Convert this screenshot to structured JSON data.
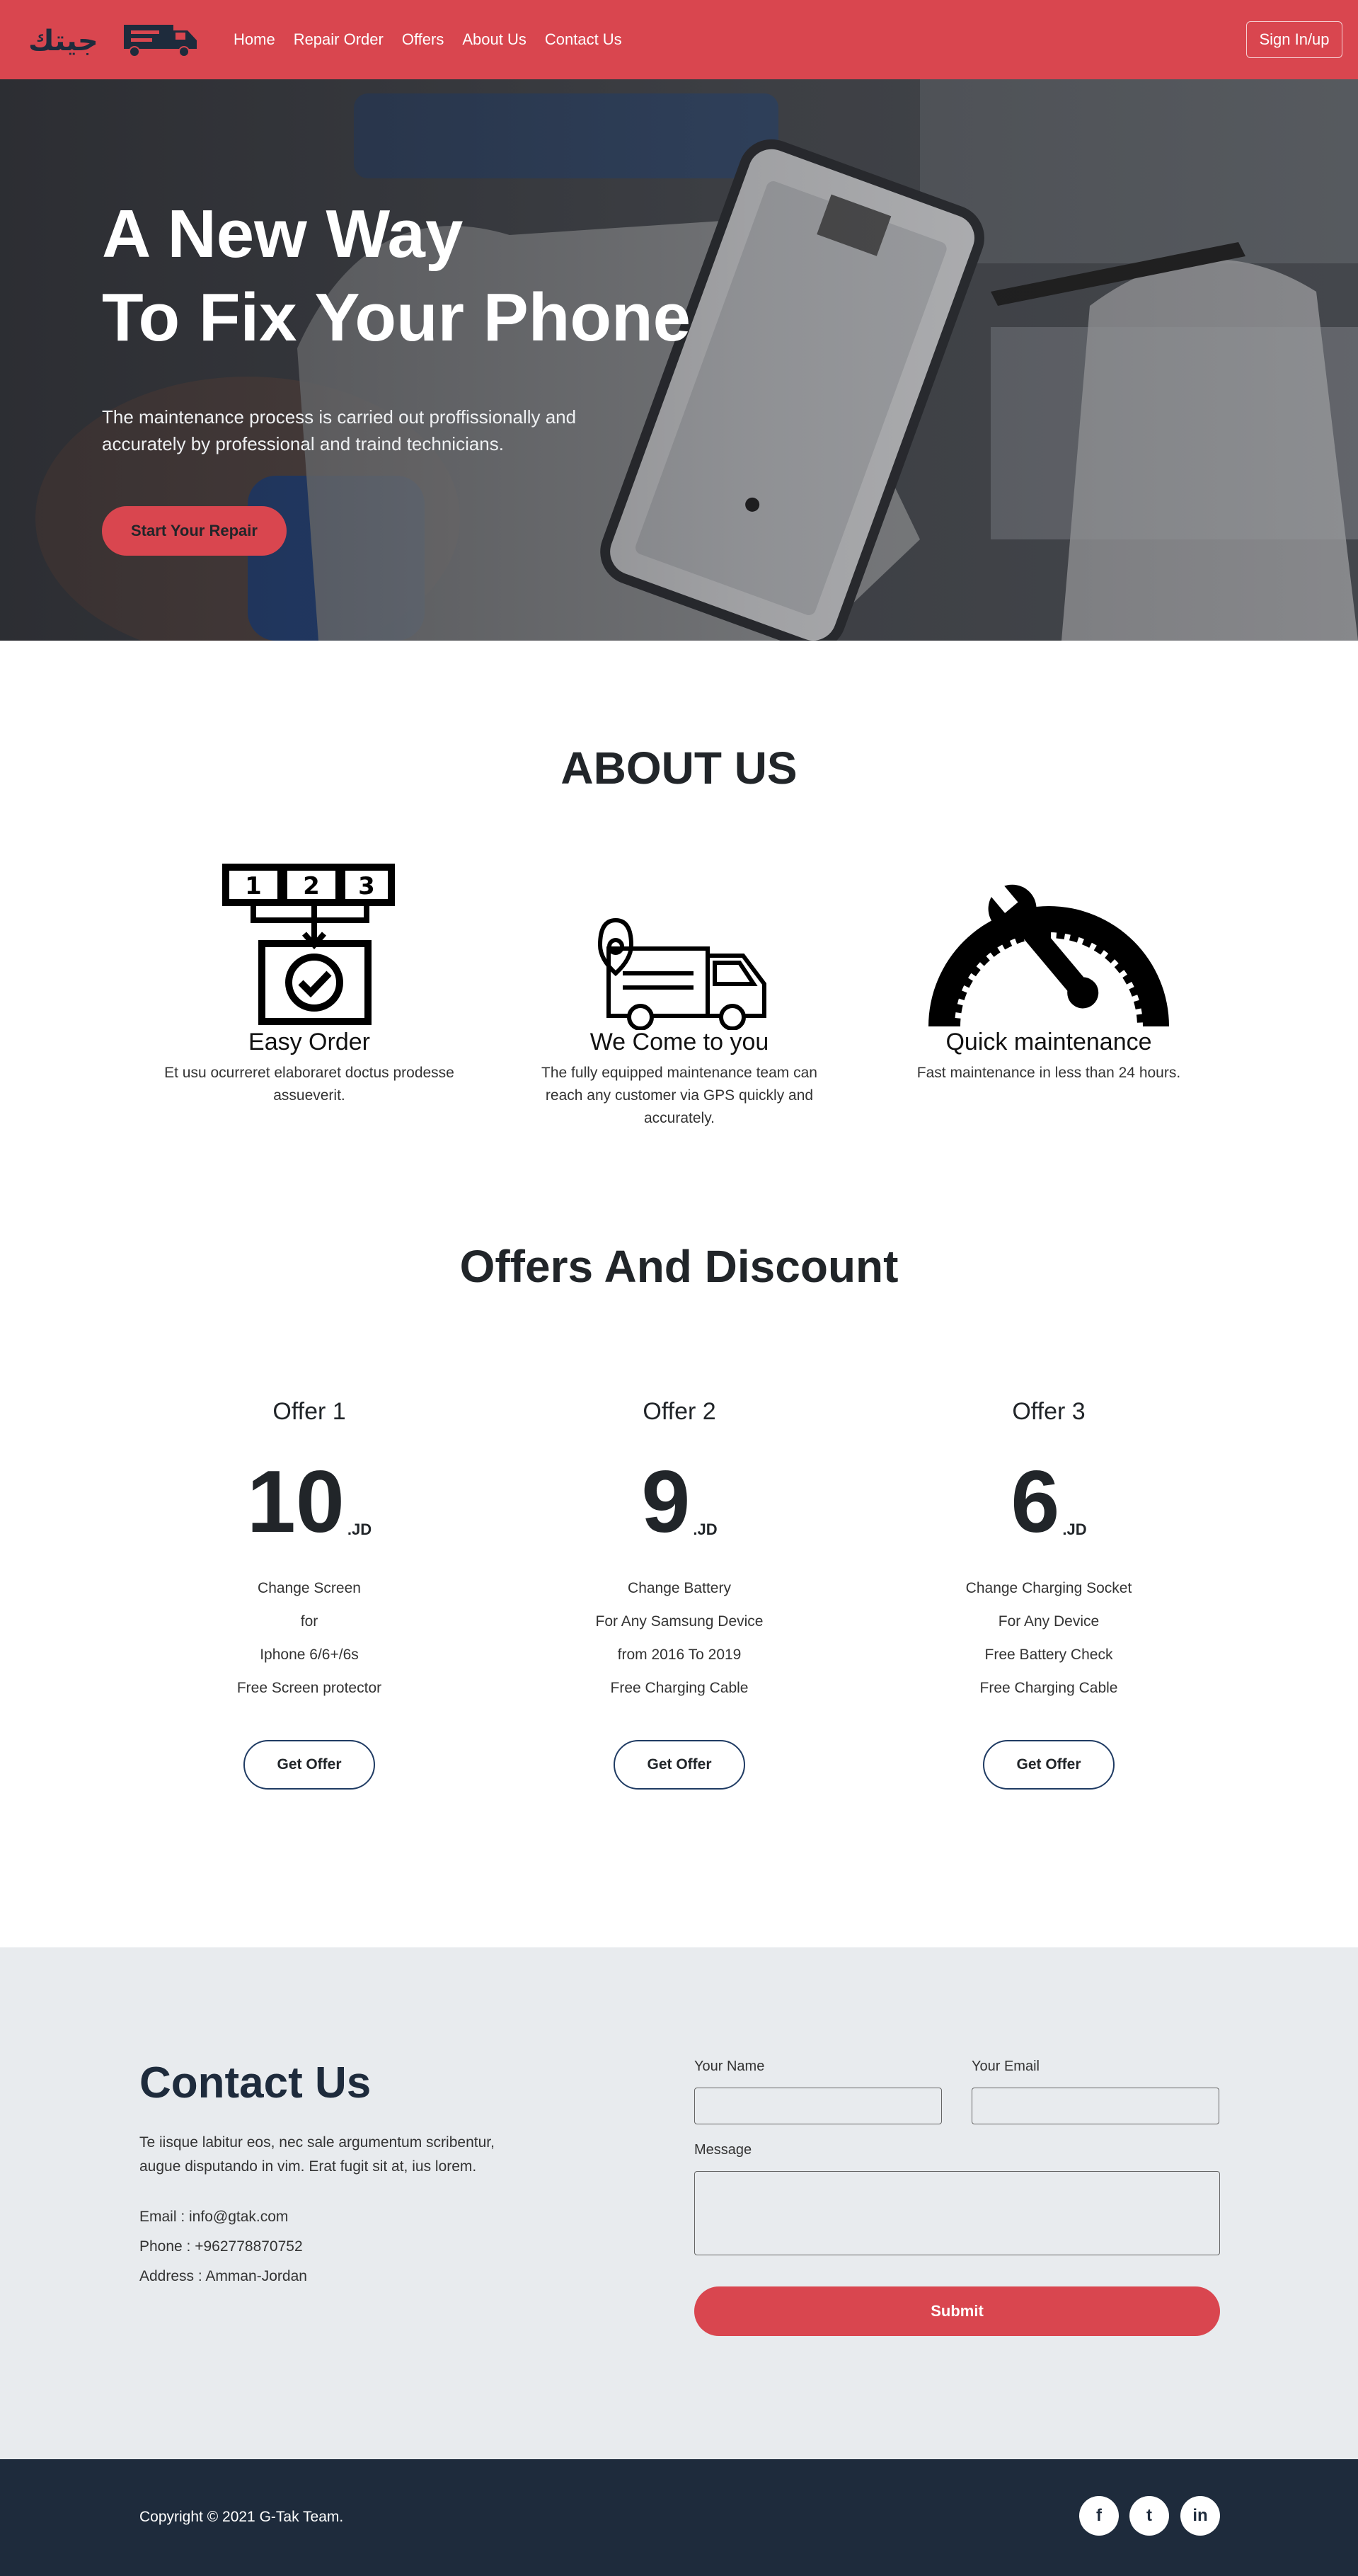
{
  "brand": {
    "logo_text": "جيتك",
    "accent": "#d9464f",
    "dark": "#1e2b3c"
  },
  "nav": {
    "items": [
      "Home",
      "Repair Order",
      "Offers",
      "About Us",
      "Contact Us"
    ],
    "signin_label": "Sign In/up"
  },
  "hero": {
    "title_line1": "A New Way",
    "title_line2": "To Fix Your Phone",
    "text": "The maintenance process is carried out proffissionally and accurately by professional and traind technicians.",
    "button_label": "Start Your Repair"
  },
  "about": {
    "title": "ABOUT US",
    "features": [
      {
        "icon": "steps-order-icon",
        "step_numbers": [
          "1",
          "2",
          "3"
        ],
        "title": "Easy Order",
        "text": "Et usu ocurreret elaboraret doctus prodesse assueverit."
      },
      {
        "icon": "delivery-truck-icon",
        "title": "We Come to you",
        "text": "The fully equipped maintenance team can reach any customer via GPS quickly and accurately."
      },
      {
        "icon": "speedometer-wrench-icon",
        "title": "Quick maintenance",
        "text": "Fast maintenance in less than 24 hours."
      }
    ]
  },
  "offers": {
    "title": "Offers And Discount",
    "items": [
      {
        "name": "Offer 1",
        "price": "10",
        "unit": ".JD",
        "lines": [
          "Change Screen",
          "for",
          "Iphone 6/6+/6s",
          "Free Screen protector"
        ],
        "button": "Get Offer"
      },
      {
        "name": "Offer 2",
        "price": "9",
        "unit": ".JD",
        "lines": [
          "Change Battery",
          "For Any Samsung Device",
          "from 2016 To 2019",
          "Free Charging Cable"
        ],
        "button": "Get Offer"
      },
      {
        "name": "Offer 3",
        "price": "6",
        "unit": ".JD",
        "lines": [
          "Change Charging Socket",
          "For Any Device",
          "Free Battery Check",
          "Free Charging Cable"
        ],
        "button": "Get Offer"
      }
    ]
  },
  "contact": {
    "title": "Contact Us",
    "text": "Te iisque labitur eos, nec sale argumentum scribentur, augue disputando in vim. Erat fugit sit at, ius lorem.",
    "email": "Email : info@gtak.com",
    "phone": "Phone : +962778870752",
    "address": "Address : Amman-Jordan",
    "form": {
      "name_label": "Your Name",
      "email_label": "Your Email",
      "message_label": "Message",
      "name_value": "",
      "email_value": "",
      "message_value": "",
      "submit_label": "Submit"
    }
  },
  "footer": {
    "copyright": "Copyright © 2021 G-Tak Team.",
    "social": [
      {
        "icon": "facebook-icon",
        "glyph": "f"
      },
      {
        "icon": "twitter-icon",
        "glyph": "t"
      },
      {
        "icon": "linkedin-icon",
        "glyph": "in"
      }
    ]
  }
}
